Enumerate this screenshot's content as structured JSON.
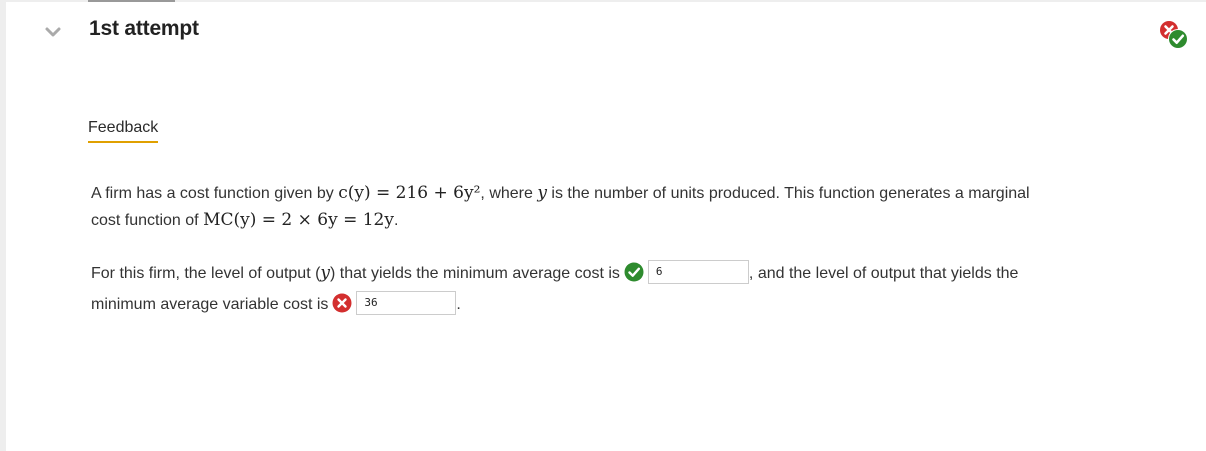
{
  "attempt": {
    "title": "1st attempt"
  },
  "feedback": {
    "tab_label": "Feedback"
  },
  "question": {
    "p1_a": "A firm has a cost function given by ",
    "p1_math1": "c(y) = 216 + 6y²",
    "p1_b": ", where ",
    "p1_var": "y",
    "p1_c": " is the number of units produced. This function generates a marginal",
    "p1_d": "cost function of ",
    "p1_math2": "MC(y) = 2 × 6y = 12y",
    "p1_e": ".",
    "p2_a": "For this firm, the level of output (",
    "p2_var": "y",
    "p2_b": ") that yields the minimum average cost is",
    "p2_c": ", and the level of output that yields the",
    "p2_d": "minimum average variable cost is",
    "p2_e": "."
  },
  "answers": [
    {
      "value": "6",
      "status": "correct"
    },
    {
      "value": "36",
      "status": "incorrect"
    }
  ],
  "icons": {
    "collapse": "chevron-down-icon",
    "status": "mixed-result-icon",
    "correct": "check-circle-icon",
    "incorrect": "x-circle-icon"
  },
  "colors": {
    "correct": "#2e8b2e",
    "incorrect": "#d32f2f",
    "tab_underline": "#e0a000"
  }
}
